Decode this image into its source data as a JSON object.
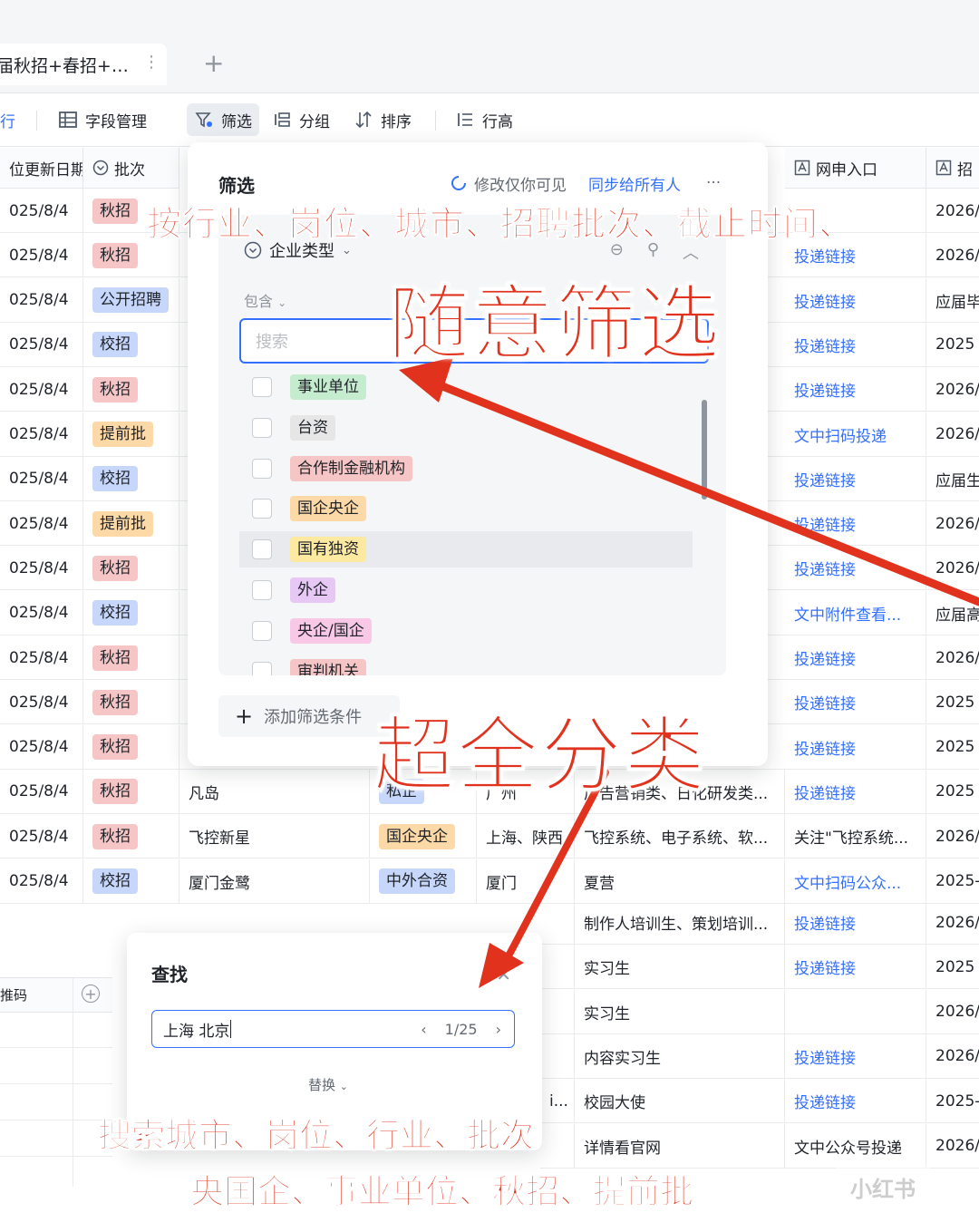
{
  "tab": {
    "title": "届秋招+春招+…",
    "menu": "⋮",
    "add": "+"
  },
  "toolbar": {
    "row_label": "行",
    "fields": "字段管理",
    "filter": "筛选",
    "group": "分组",
    "sort": "排序",
    "row_height": "行高"
  },
  "columns": {
    "date": "位更新日期",
    "batch": "批次",
    "entry": "网申入口",
    "deadline": "招"
  },
  "rows": [
    {
      "date": "025/8/4",
      "batch": "秋招",
      "entry": "",
      "deadline": "2026/"
    },
    {
      "date": "025/8/4",
      "batch": "秋招",
      "entry": "投递链接",
      "deadline": "2026/"
    },
    {
      "date": "025/8/4",
      "batch": "公开招聘",
      "entry": "投递链接",
      "deadline": "应届毕"
    },
    {
      "date": "025/8/4",
      "batch": "校招",
      "entry": "投递链接",
      "deadline": "2025"
    },
    {
      "date": "025/8/4",
      "batch": "秋招",
      "entry": "投递链接",
      "deadline": "2026/"
    },
    {
      "date": "025/8/4",
      "batch": "提前批",
      "entry": "文中扫码投递",
      "deadline": "2026/"
    },
    {
      "date": "025/8/4",
      "batch": "校招",
      "entry": "投递链接",
      "deadline": "应届生"
    },
    {
      "date": "025/8/4",
      "batch": "提前批",
      "entry": "投递链接",
      "deadline": "2026/"
    },
    {
      "date": "025/8/4",
      "batch": "秋招",
      "entry": "投递链接",
      "deadline": "2026/"
    },
    {
      "date": "025/8/4",
      "batch": "校招",
      "entry": "文中附件查看...",
      "deadline": "应届高"
    },
    {
      "date": "025/8/4",
      "batch": "秋招",
      "entry": "投递链接",
      "deadline": "2026/"
    },
    {
      "date": "025/8/4",
      "batch": "秋招",
      "entry": "投递链接",
      "deadline": "2025"
    },
    {
      "date": "025/8/4",
      "batch": "秋招",
      "entry": "投递链接",
      "deadline": "2025"
    },
    {
      "date": "025/8/4",
      "batch": "秋招",
      "name": "凡岛",
      "type": "私企",
      "city": "广州",
      "pos": "广告营销类、日化研发类...",
      "entry": "投递链接",
      "deadline": "2025"
    },
    {
      "date": "025/8/4",
      "batch": "秋招",
      "name": "飞控新星",
      "type": "国企央企",
      "city": "上海、陕西",
      "pos": "飞控系统、电子系统、软...",
      "entry": "关注\"飞控系统...",
      "deadline": "2026/"
    },
    {
      "date": "025/8/4",
      "batch": "校招",
      "name": "厦门金鹭",
      "type": "中外合资",
      "city": "厦门",
      "pos": "夏营",
      "entry": "文中扫码公众...",
      "deadline": "2025-"
    }
  ],
  "lower_rows": [
    {
      "left": "",
      "pos": "制作人培训生、策划培训...",
      "entry": "投递链接",
      "deadline": "2026/"
    },
    {
      "left": "",
      "pos": "实习生",
      "entry": "投递链接",
      "deadline": "2025"
    },
    {
      "left": "",
      "pos": "实习生",
      "entry": "",
      "deadline": "2026/"
    },
    {
      "left": "",
      "pos": "内容实习生",
      "entry": "投递链接",
      "deadline": "2026/"
    },
    {
      "left": "i...",
      "pos": "校园大使",
      "entry": "投递链接",
      "deadline": "2025-"
    },
    {
      "left": "",
      "pos": "详情看官网",
      "entry": "文中公众号投递",
      "deadline": "2026/"
    }
  ],
  "filter": {
    "title": "筛选",
    "visibility": "修改仅你可见",
    "sync": "同步给所有人",
    "more": "···",
    "condition_field": "企业类型",
    "operator": "包含",
    "search_placeholder": "搜索",
    "options": [
      {
        "label": "事业单位",
        "bg": "#c6ecd0",
        "fg": "#1f2329"
      },
      {
        "label": "台资",
        "bg": "#e6e6e6",
        "fg": "#1f2329"
      },
      {
        "label": "合作制金融机构",
        "bg": "#f6c6c6",
        "fg": "#1f2329"
      },
      {
        "label": "国企央企",
        "bg": "#fcd9a6",
        "fg": "#1f2329"
      },
      {
        "label": "国有独资",
        "bg": "#fde9a0",
        "fg": "#1f2329"
      },
      {
        "label": "外企",
        "bg": "#e7c8f5",
        "fg": "#1f2329"
      },
      {
        "label": "央企/国企",
        "bg": "#f8c8e6",
        "fg": "#1f2329"
      },
      {
        "label": "审判机关",
        "bg": "#f6c6c6",
        "fg": "#1f2329"
      }
    ],
    "add_condition": "添加筛选条件"
  },
  "find": {
    "title": "查找",
    "query": "上海 北京",
    "counter": "1/25",
    "replace": "替换"
  },
  "mini_table": {
    "header": "推码"
  },
  "overlays": {
    "line1": "按行业、岗位、城市、招聘批次、截止时间、",
    "big1": "随意筛选",
    "big2": "超全分类",
    "bottom1": "搜索城市、岗位、行业、批次",
    "bottom2": "央国企、事业单位、秋招、提前批",
    "watermark": "小红书"
  },
  "colors": {
    "accent": "#3370ff",
    "overlay_red": "#e0321c",
    "tag_autumn": "#f6c6c6",
    "tag_campus": "#c7d7fb",
    "tag_public": "#c7d7fb",
    "tag_early": "#fcd9a6"
  }
}
